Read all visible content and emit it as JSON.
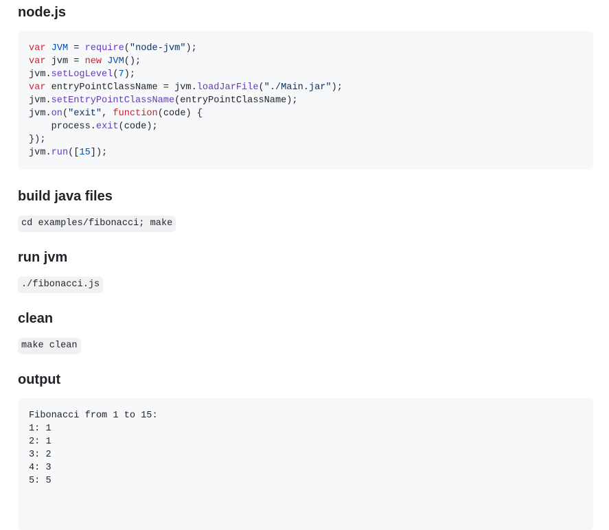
{
  "sections": {
    "node": {
      "heading": "node.js",
      "code_lines": [
        [
          {
            "t": "var",
            "c": "kw"
          },
          {
            "t": " ",
            "c": "plain"
          },
          {
            "t": "JVM",
            "c": "cls"
          },
          {
            "t": " = ",
            "c": "plain"
          },
          {
            "t": "require",
            "c": "fn"
          },
          {
            "t": "(",
            "c": "plain"
          },
          {
            "t": "\"node-jvm\"",
            "c": "str"
          },
          {
            "t": ");",
            "c": "plain"
          }
        ],
        [
          {
            "t": "var",
            "c": "kw"
          },
          {
            "t": " jvm = ",
            "c": "plain"
          },
          {
            "t": "new",
            "c": "kw"
          },
          {
            "t": " ",
            "c": "plain"
          },
          {
            "t": "JVM",
            "c": "cls"
          },
          {
            "t": "();",
            "c": "plain"
          }
        ],
        [
          {
            "t": "jvm.",
            "c": "plain"
          },
          {
            "t": "setLogLevel",
            "c": "fn"
          },
          {
            "t": "(",
            "c": "plain"
          },
          {
            "t": "7",
            "c": "num"
          },
          {
            "t": ");",
            "c": "plain"
          }
        ],
        [
          {
            "t": "var",
            "c": "kw"
          },
          {
            "t": " entryPointClassName = jvm.",
            "c": "plain"
          },
          {
            "t": "loadJarFile",
            "c": "fn"
          },
          {
            "t": "(",
            "c": "plain"
          },
          {
            "t": "\"./Main.jar\"",
            "c": "str"
          },
          {
            "t": ");",
            "c": "plain"
          }
        ],
        [
          {
            "t": "jvm.",
            "c": "plain"
          },
          {
            "t": "setEntryPointClassName",
            "c": "fn"
          },
          {
            "t": "(entryPointClassName);",
            "c": "plain"
          }
        ],
        [
          {
            "t": "jvm.",
            "c": "plain"
          },
          {
            "t": "on",
            "c": "fn"
          },
          {
            "t": "(",
            "c": "plain"
          },
          {
            "t": "\"exit\"",
            "c": "str"
          },
          {
            "t": ", ",
            "c": "plain"
          },
          {
            "t": "function",
            "c": "kw"
          },
          {
            "t": "(code) {",
            "c": "plain"
          }
        ],
        [
          {
            "t": "    process.",
            "c": "plain"
          },
          {
            "t": "exit",
            "c": "fn"
          },
          {
            "t": "(code);",
            "c": "plain"
          }
        ],
        [
          {
            "t": "});",
            "c": "plain"
          }
        ],
        [
          {
            "t": "jvm.",
            "c": "plain"
          },
          {
            "t": "run",
            "c": "fn"
          },
          {
            "t": "([",
            "c": "plain"
          },
          {
            "t": "15",
            "c": "num"
          },
          {
            "t": "]);",
            "c": "plain"
          }
        ]
      ]
    },
    "build": {
      "heading": "build java files",
      "command": "cd examples/fibonacci; make"
    },
    "run": {
      "heading": "run jvm",
      "command": "./fibonacci.js"
    },
    "clean": {
      "heading": "clean",
      "command": "make clean"
    },
    "output": {
      "heading": "output",
      "lines": [
        "Fibonacci from 1 to 15:",
        "1: 1",
        "2: 1",
        "3: 2",
        "4: 3",
        "5: 5"
      ]
    }
  },
  "colors": {
    "keyword": "#cf222e",
    "class": "#0550ae",
    "function": "#6639ba",
    "string": "#0a3069",
    "number": "#0550ae",
    "code_background": "#f6f8fa"
  }
}
